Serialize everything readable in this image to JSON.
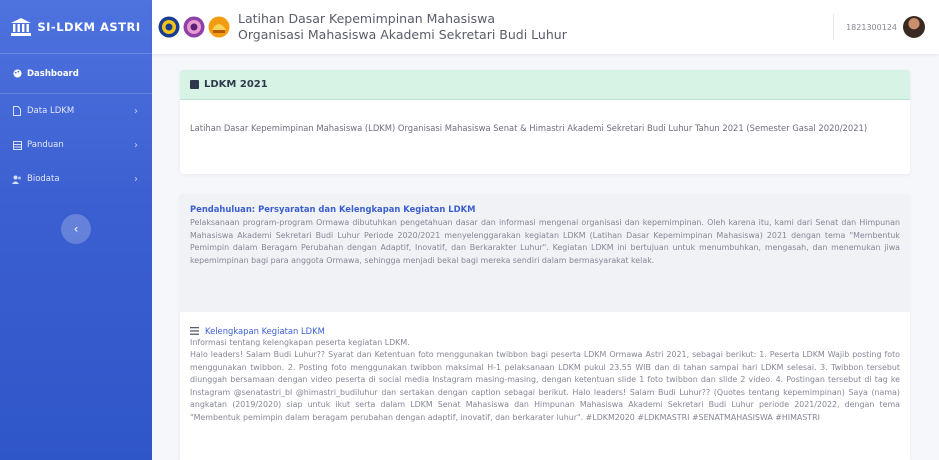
{
  "brand": {
    "title": "SI-LDKM ASTRI",
    "icon": "institution-icon"
  },
  "sidebar": {
    "items": [
      {
        "label": "Dashboard",
        "icon": "palette-icon"
      },
      {
        "label": "Data LDKM",
        "icon": "file-icon"
      },
      {
        "label": "Panduan",
        "icon": "table-icon"
      },
      {
        "label": "Biodata",
        "icon": "users-icon"
      }
    ],
    "toggle_icon": "chevron-left-icon"
  },
  "header": {
    "line1": "Latihan Dasar Kepemimpinan Mahasiswa",
    "line2": "Organisasi Mahasiswa Akademi Sekretari Budi Luhur",
    "user_id": "1821300124"
  },
  "ldkm": {
    "title": "LDKM 2021",
    "description": "Latihan Dasar Kepemimpinan Mahasiswa (LDKM) Organisasi Mahasiswa Senat & Himastri Akademi Sekretari Budi Luhur Tahun 2021 (Semester Gasal 2020/2021)"
  },
  "pendahuluan": {
    "title": "Pendahuluan: Persyaratan dan Kelengkapan Kegiatan LDKM",
    "text": "Pelaksanaan program-program Ormawa dibutuhkan pengetahuan dasar dan informasi mengenai organisasi dan kepemimpinan. Oleh karena itu, kami dari Senat dan Himpunan Mahasiswa Akademi Sekretari Budi Luhur Periode 2020/2021 menyelenggarakan kegiatan LDKM (Latihan Dasar Kepemimpinan Mahasiswa) 2021 dengan tema \"Membentuk Pemimpin dalam Beragam Perubahan dengan Adaptif, Inovatif, dan Berkarakter Luhur\". Kegiatan LDKM ini bertujuan untuk menumbuhkan, mengasah, dan menemukan jiwa kepemimpinan bagi para anggota Ormawa, sehingga menjadi bekal bagi mereka sendiri dalam bermasyarakat kelak."
  },
  "kelengkapan": {
    "title": "Kelengkapan Kegiatan LDKM",
    "subtitle": "Informasi tentang kelengkapan peserta kegiatan LDKM.",
    "text": "Halo leaders! Salam Budi Luhur?? Syarat dan Ketentuan foto menggunakan twibbon bagi peserta LDKM Ormawa Astri 2021, sebagai berikut: 1. Peserta LDKM Wajib posting foto menggunakan twibbon. 2. Posting foto menggunakan twibbon maksimal H-1 pelaksanaan LDKM pukul 23.55 WIB dan di tahan sampai hari LDKM selesai. 3. Twibbon tersebut diunggah bersamaan dengan video peserta di social media Instagram masing-masing, dengan ketentuan slide 1 foto twibbon dan slide 2 video. 4. Postingan tersebut di tag ke Instagram @senatastri_bl @himastri_budiluhur dan sertakan dengan caption sebagai berikut. Halo leaders! Salam Budi Luhur?? (Quotes tentang kepemimpinan) Saya (nama) angkatan (2019/2020) siap untuk ikut serta dalam LDKM Senat Mahasiswa dan Himpunan Mahasiswa Akademi Sekretari Budi Luhur periode 2021/2022, dengan tema \"Membentuk pemimpin dalam beragam perubahan dengan adaptif, inovatif, dan berkarater luhur\". #LDKM2020 #LDKMASTRI #SENATMAHASISWA #HIMASTRI"
  },
  "colors": {
    "primary": "#4e73df",
    "header_green": "#d7f3e6",
    "link": "#3b5fd0"
  }
}
